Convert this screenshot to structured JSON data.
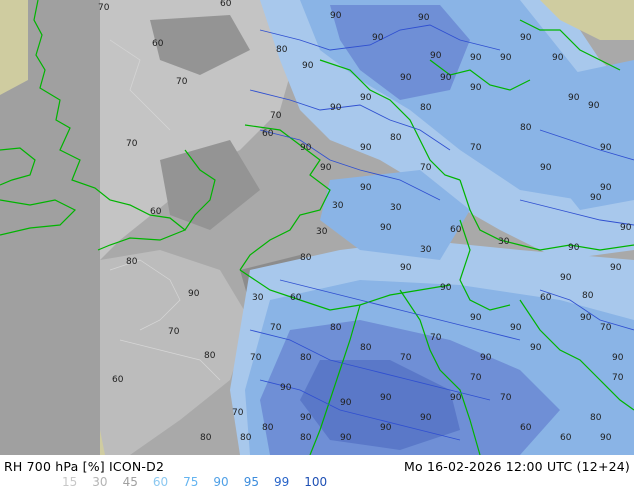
{
  "title": {
    "left": "RH 700 hPa [%] ICON-D2",
    "right": "Mo 16-02-2026 12:00 UTC (12+24)"
  },
  "legend": [
    {
      "label": "15",
      "color": "#c8c8c8"
    },
    {
      "label": "30",
      "color": "#b4b4b4"
    },
    {
      "label": "45",
      "color": "#a0a0a0"
    },
    {
      "label": "60",
      "color": "#8cc8f0"
    },
    {
      "label": "75",
      "color": "#64b4f0"
    },
    {
      "label": "90",
      "color": "#50a0e6"
    },
    {
      "label": "95",
      "color": "#3c8cdc"
    },
    {
      "label": "99",
      "color": "#2864c8"
    },
    {
      "label": "100",
      "color": "#1e50b4"
    }
  ],
  "map": {
    "colors": {
      "background_gray": "#a9a9a9",
      "light_gray": "#c4c4c4",
      "dark_gray": "#8c8c8c",
      "tan_outside_domain": "#cfcca0",
      "light_blue": "#a8c8ec",
      "mid_blue": "#8ab4e6",
      "dark_blue": "#6f8fd6",
      "coast_green": "#00b400",
      "contour_blue": "#3050d0"
    },
    "contour_labels": [
      "70",
      "60",
      "60",
      "70",
      "80",
      "90",
      "90",
      "90",
      "90",
      "90",
      "90",
      "80",
      "70",
      "60",
      "60",
      "70",
      "80",
      "90",
      "70",
      "80",
      "60",
      "30",
      "60",
      "30",
      "30",
      "30",
      "30",
      "60",
      "30",
      "60",
      "90",
      "80",
      "70",
      "70",
      "80",
      "90",
      "90",
      "90",
      "90",
      "90",
      "90",
      "80",
      "70",
      "70",
      "90",
      "90",
      "90",
      "90",
      "90",
      "90",
      "90",
      "90",
      "90",
      "90",
      "90",
      "90",
      "90",
      "80",
      "80",
      "80",
      "80",
      "70",
      "70",
      "70",
      "70",
      "60",
      "60",
      "90",
      "90",
      "90",
      "90",
      "90",
      "90",
      "90",
      "90",
      "90",
      "90",
      "90",
      "90",
      "90",
      "90",
      "90",
      "90",
      "90",
      "90",
      "80",
      "80",
      "70",
      "70",
      "70",
      "80",
      "80",
      "80",
      "90",
      "90"
    ]
  }
}
